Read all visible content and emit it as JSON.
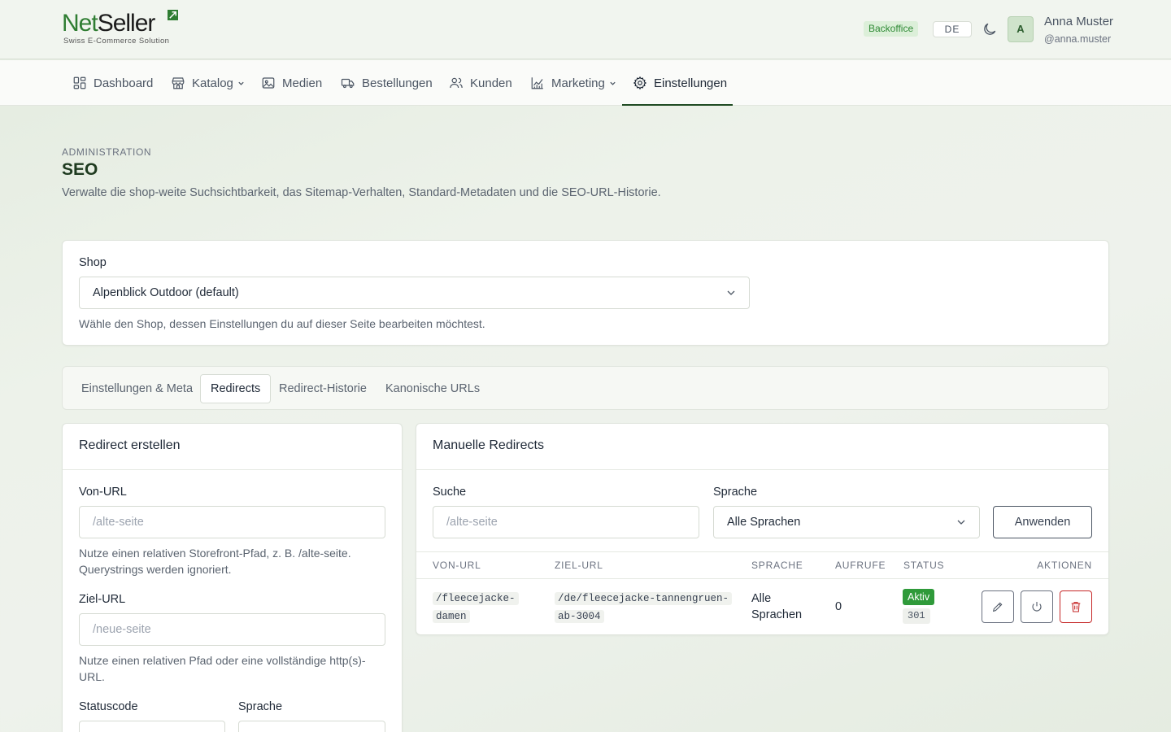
{
  "brand": {
    "name_part1": "Net",
    "name_part2": "Seller",
    "tagline": "Swiss E-Commerce Solution"
  },
  "header": {
    "badge": "Backoffice",
    "language": "DE",
    "avatar_initial": "A",
    "user_name": "Anna Muster",
    "user_handle": "@anna.muster"
  },
  "nav": {
    "items": [
      {
        "label": "Dashboard",
        "icon": "dashboard-icon"
      },
      {
        "label": "Katalog",
        "icon": "store-icon",
        "dropdown": true
      },
      {
        "label": "Medien",
        "icon": "image-icon"
      },
      {
        "label": "Bestellungen",
        "icon": "truck-icon"
      },
      {
        "label": "Kunden",
        "icon": "users-icon"
      },
      {
        "label": "Marketing",
        "icon": "chart-icon",
        "dropdown": true
      },
      {
        "label": "Einstellungen",
        "icon": "gear-icon",
        "active": true
      }
    ]
  },
  "page": {
    "eyebrow": "ADMINISTRATION",
    "title": "SEO",
    "description": "Verwalte die shop-weite Suchsichtbarkeit, das Sitemap-Verhalten, Standard-Metadaten und die SEO-URL-Historie."
  },
  "shop_selector": {
    "label": "Shop",
    "value": "Alpenblick Outdoor (default)",
    "help": "Wähle den Shop, dessen Einstellungen du auf dieser Seite bearbeiten möchtest."
  },
  "tabs": [
    {
      "label": "Einstellungen & Meta"
    },
    {
      "label": "Redirects",
      "active": true
    },
    {
      "label": "Redirect-Historie"
    },
    {
      "label": "Kanonische URLs"
    }
  ],
  "create_redirect": {
    "title": "Redirect erstellen",
    "from_label": "Von-URL",
    "from_placeholder": "/alte-seite",
    "from_help": "Nutze einen relativen Storefront-Pfad, z. B. /alte-seite. Querystrings werden ignoriert.",
    "to_label": "Ziel-URL",
    "to_placeholder": "/neue-seite",
    "to_help": "Nutze einen relativen Pfad oder eine vollständige http(s)-URL.",
    "status_label": "Statuscode",
    "language_label": "Sprache"
  },
  "manual_redirects": {
    "title": "Manuelle Redirects",
    "search_label": "Suche",
    "search_placeholder": "/alte-seite",
    "language_label": "Sprache",
    "language_value": "Alle Sprachen",
    "apply_label": "Anwenden",
    "columns": [
      "VON-URL",
      "ZIEL-URL",
      "SPRACHE",
      "AUFRUFE",
      "STATUS",
      "AKTIONEN"
    ],
    "rows": [
      {
        "from_line1": "/fleecejacke-",
        "from_line2": "damen",
        "to_line1": "/de/fleecejacke-tannengruen-",
        "to_line2": "ab-3004",
        "language_line1": "Alle",
        "language_line2": "Sprachen",
        "hits": "0",
        "status": "Aktiv",
        "code": "301"
      }
    ]
  },
  "colors": {
    "brand_green": "#2f7d32",
    "dark_green": "#1e4a22",
    "active_badge": "#2f9a3a",
    "danger": "#c62828"
  }
}
